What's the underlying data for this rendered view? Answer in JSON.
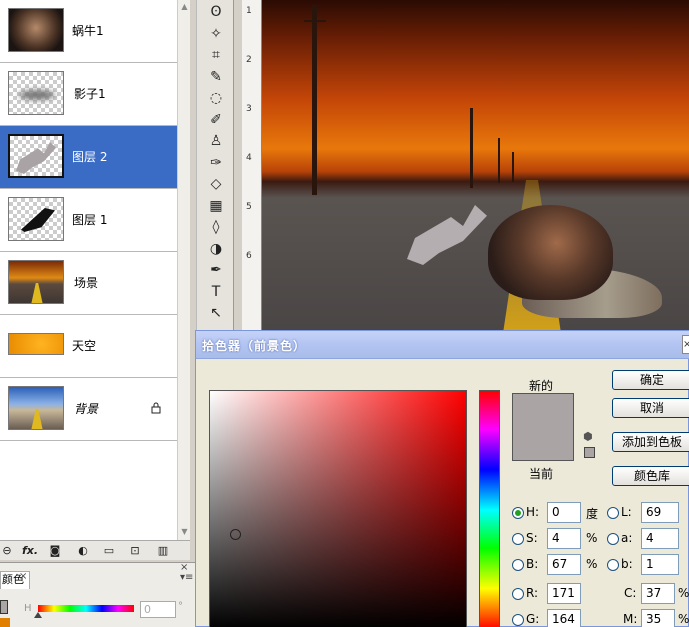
{
  "layers": [
    {
      "name": "蜗牛1",
      "selected": false,
      "locked": false,
      "thumb": "snail"
    },
    {
      "name": "影子1",
      "selected": false,
      "locked": false,
      "thumb": "shadow-blur"
    },
    {
      "name": "图层 2",
      "selected": true,
      "locked": false,
      "thumb": "shadow-shape"
    },
    {
      "name": "图层 1",
      "selected": false,
      "locked": false,
      "thumb": "dark-shape"
    },
    {
      "name": "场景",
      "selected": false,
      "locked": false,
      "thumb": "road"
    },
    {
      "name": "天空",
      "selected": false,
      "locked": false,
      "thumb": "sky-orange"
    },
    {
      "name": "背景",
      "selected": false,
      "locked": true,
      "thumb": "road-blue"
    }
  ],
  "layers_footer_icons": [
    "link-icon",
    "fx-icon",
    "mask-icon",
    "adjustment-icon",
    "folder-icon",
    "new-layer-icon",
    "trash-icon"
  ],
  "layers_footer_fx": "fx.",
  "color_panel": {
    "tab_label": "颜色",
    "close": "×",
    "h_label": "H",
    "h_value": "0",
    "deg": "°",
    "fg_color": "#aba4a4",
    "bg_color": "#e07f00"
  },
  "tools": [
    "lasso-icon",
    "magic-wand-icon",
    "crop-icon",
    "eyedropper-icon",
    "healing-icon",
    "brush-icon",
    "stamp-icon",
    "history-brush-icon",
    "eraser-icon",
    "gradient-icon",
    "blur-icon",
    "dodge-icon",
    "pen-icon",
    "type-icon",
    "selection-icon"
  ],
  "tool_glyphs": [
    "ʘ",
    "✧",
    "⌗",
    "✎",
    "◌",
    "✐",
    "♙",
    "✑",
    "◇",
    "▦",
    "◊",
    "◑",
    "✒",
    "T",
    "↖"
  ],
  "ruler_ticks": [
    "1",
    "2",
    "3",
    "4",
    "5",
    "6"
  ],
  "picker": {
    "title": "拾色器（前景色）",
    "close": "×",
    "new_label": "新的",
    "current_label": "当前",
    "new_color": "#aba4a4",
    "buttons": {
      "ok": "确定",
      "cancel": "取消",
      "add_swatch": "添加到色板",
      "color_library": "颜色库"
    },
    "fields": {
      "H": {
        "label": "H:",
        "value": "0",
        "unit": "度",
        "selected": true
      },
      "S": {
        "label": "S:",
        "value": "4",
        "unit": "%"
      },
      "B": {
        "label": "B:",
        "value": "67",
        "unit": "%"
      },
      "R": {
        "label": "R:",
        "value": "171"
      },
      "G": {
        "label": "G:",
        "value": "164"
      },
      "L": {
        "label": "L:",
        "value": "69"
      },
      "a": {
        "label": "a:",
        "value": "4"
      },
      "b": {
        "label": "b:",
        "value": "1"
      },
      "C": {
        "label": "C:",
        "value": "37",
        "unit": "%"
      },
      "M": {
        "label": "M:",
        "value": "35",
        "unit": "%"
      }
    }
  }
}
